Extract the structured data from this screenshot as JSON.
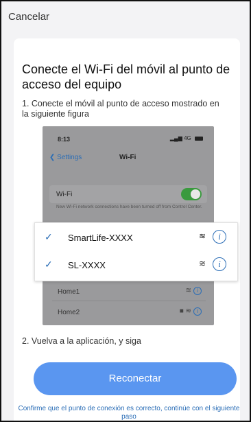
{
  "header": {
    "cancel_label": "Cancelar"
  },
  "title": "Conecte el Wi-Fi del móvil al punto de acceso del equipo",
  "step1": "1. Conecte el móvil al punto de  acceso mostrado en la siguiente figura",
  "phone": {
    "time": "8:13",
    "status": "4G",
    "back_label": "Settings",
    "screen_title": "Wi-Fi",
    "wifi_label": "Wi-Fi",
    "note": "New Wi-Fi network connections have been turned off from Control Center.",
    "other_networks": [
      "Home1",
      "Home2"
    ]
  },
  "networks": [
    {
      "name": "SmartLife-XXXX"
    },
    {
      "name": "SL-XXXX"
    }
  ],
  "step2": "2. Vuelva a la aplicación, y siga",
  "reconnect_label": "Reconectar",
  "help_link": "Confirme que el punto de conexión es correcto, continúe con el siguiente paso",
  "colors": {
    "accent": "#5a96f0",
    "link": "#2a6db6",
    "toggle_on": "#3a9a3e"
  },
  "icons": {
    "check": "check-icon",
    "wifi": "wifi-icon",
    "info": "info-icon",
    "lock": "lock-icon",
    "chevron": "chevron-left-icon"
  }
}
